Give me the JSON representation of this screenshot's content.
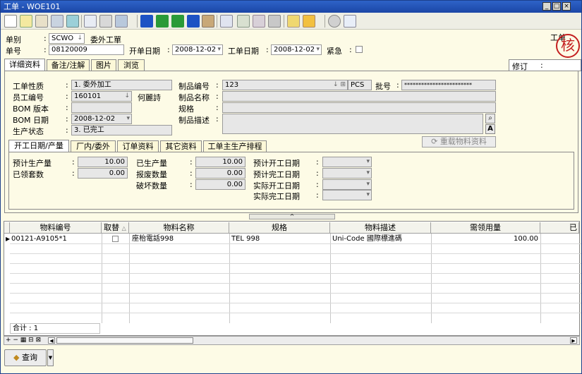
{
  "window": {
    "title": "工单 - WOE101",
    "corner_label": "工单",
    "stamp_text": "核"
  },
  "header": {
    "doc_type_label": "单别",
    "doc_type_value": "SCWO",
    "doc_type_desc": "委外工單",
    "doc_no_label": "单号",
    "doc_no_value": "08120009",
    "open_date_label": "开单日期",
    "open_date_value": "2008-12-02",
    "work_date_label": "工单日期",
    "work_date_value": "2008-12-02",
    "urgent_label": "紧急"
  },
  "top_tabs": [
    "详细资料",
    "备注/注解",
    "图片",
    "浏览"
  ],
  "revise_label": "修订",
  "details": {
    "nature_label": "工单性质",
    "nature_value": "1. 委外加工",
    "employee_label": "员工编号",
    "employee_value": "160101",
    "employee_name": "何麗詩",
    "bom_ver_label": "BOM 版本",
    "bom_date_label": "BOM 日期",
    "bom_date_value": "2008-12-02",
    "status_label": "生产状态",
    "status_value": "3. 已完工",
    "product_no_label": "制品编号",
    "product_no_value": "123",
    "unit_value": "PCS",
    "batch_label": "批号",
    "batch_value": "************************",
    "product_name_label": "制品名称",
    "spec_label": "规格",
    "product_desc_label": "制品描述",
    "reload_button": "重载物料资料"
  },
  "sub_tabs": [
    "开工日期/产量",
    "厂内/委外",
    "订单资料",
    "其它资料",
    "工单主生产排程"
  ],
  "production": {
    "plan_qty_label": "预计生产量",
    "plan_qty_value": "10.00",
    "received_sets_label": "已领套数",
    "received_sets_value": "0.00",
    "produced_label": "已生产量",
    "produced_value": "10.00",
    "scrap_label": "报废数量",
    "scrap_value": "0.00",
    "damage_label": "破坏数量",
    "damage_value": "0.00",
    "plan_start_label": "预计开工日期",
    "plan_end_label": "预计完工日期",
    "actual_start_label": "实际开工日期",
    "actual_end_label": "实际完工日期"
  },
  "grid": {
    "columns": [
      "物料编号",
      "取替",
      "物料名称",
      "规格",
      "物料描述",
      "需领用量",
      "已"
    ],
    "rows": [
      {
        "item_no": "00121-A9105*1",
        "name": "座枱電話998",
        "spec": "TEL 998",
        "desc": "Uni-Code 國際標進碼",
        "qty": "100.00"
      }
    ],
    "total_label": "合计 : 1"
  },
  "footer": {
    "query_button": "查询"
  },
  "colors": {
    "titlebar": "#2e63c8",
    "panel_bg": "#fdfbe6",
    "stamp": "#c42020"
  }
}
